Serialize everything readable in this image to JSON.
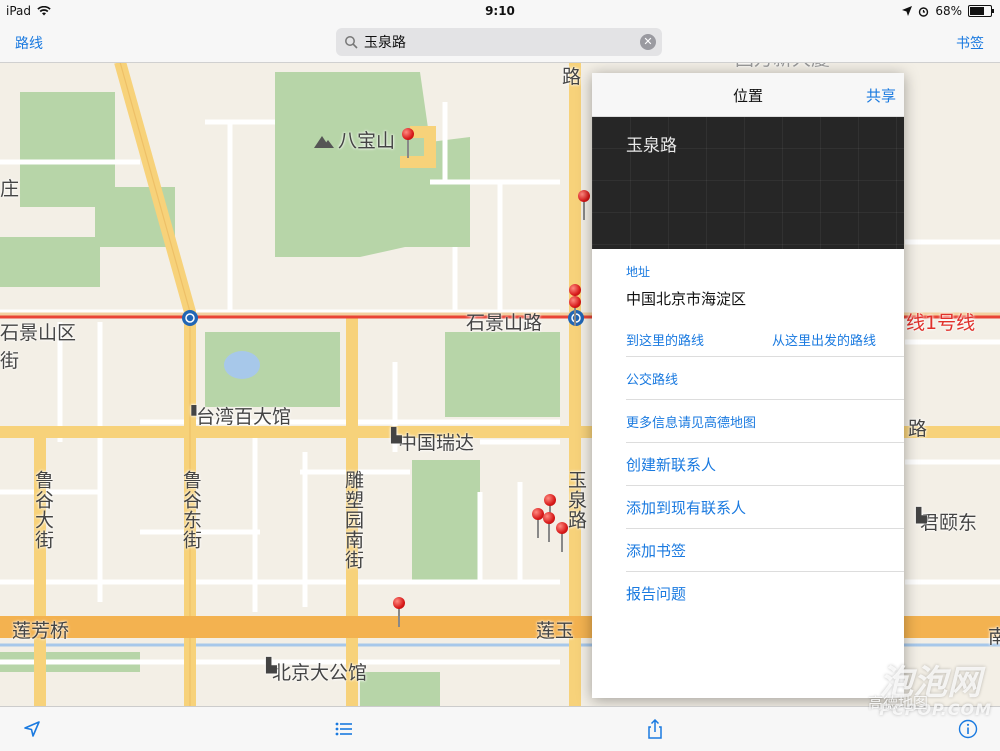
{
  "status_bar": {
    "device": "iPad",
    "time": "9:10",
    "battery": "68%",
    "battery_level": 0.68
  },
  "nav": {
    "left": "路线",
    "right": "书签"
  },
  "search": {
    "value": "玉泉路"
  },
  "map": {
    "labels": [
      {
        "text": "八宝山",
        "name": "map-label-babaoshan"
      },
      {
        "text": "庄",
        "name": "map-label-zhuang"
      },
      {
        "text": "石景山区",
        "name": "map-label-shijingshan-district"
      },
      {
        "text": "石景山路",
        "name": "map-label-shijingshan-road"
      },
      {
        "text": "路",
        "name": "map-label-lu-top"
      },
      {
        "text": "台湾百大馆",
        "name": "map-label-taiwan-baida"
      },
      {
        "text": "中国瑞达",
        "name": "map-label-zhongguo-ruida"
      },
      {
        "text": "鲁谷大街",
        "name": "map-label-lugu-dajie"
      },
      {
        "text": "鲁谷东街",
        "name": "map-label-lugu-dongjie"
      },
      {
        "text": "雕塑园南街",
        "name": "map-label-diaosuyuan-nanjie"
      },
      {
        "text": "玉泉路",
        "name": "map-label-yuquan-road"
      },
      {
        "text": "莲芳桥",
        "name": "map-label-lianfang-bridge"
      },
      {
        "text": "莲玉",
        "name": "map-label-lianyu"
      },
      {
        "text": "北京大公馆",
        "name": "map-label-beijing-dagongguan"
      },
      {
        "text": "线1号线",
        "name": "map-label-line1"
      },
      {
        "text": "路",
        "name": "map-label-lu-right"
      },
      {
        "text": "君颐东",
        "name": "map-label-junyi"
      },
      {
        "text": "南",
        "name": "map-label-nan"
      },
      {
        "text": "街",
        "name": "map-label-jie-left"
      },
      {
        "text": "国万新大厦",
        "name": "map-label-top-building"
      }
    ]
  },
  "panel": {
    "title": "位置",
    "share": "共享",
    "banner_title": "玉泉路",
    "address_label": "地址",
    "address_value": "中国北京市海淀区",
    "route_to": "到这里的路线",
    "route_from": "从这里出发的路线",
    "transit": "公交路线",
    "more_info": "更多信息请见高德地图",
    "create_contact": "创建新联系人",
    "add_existing": "添加到现有联系人",
    "add_bookmark": "添加书签",
    "report_problem": "报告问题"
  },
  "toolbar": {
    "icons": [
      "location-arrow-icon",
      "list-icon",
      "share-icon",
      "info-icon"
    ]
  },
  "watermark": {
    "main": "泡泡网",
    "sub": "PCPOP.COM",
    "logo": "高德地图"
  }
}
